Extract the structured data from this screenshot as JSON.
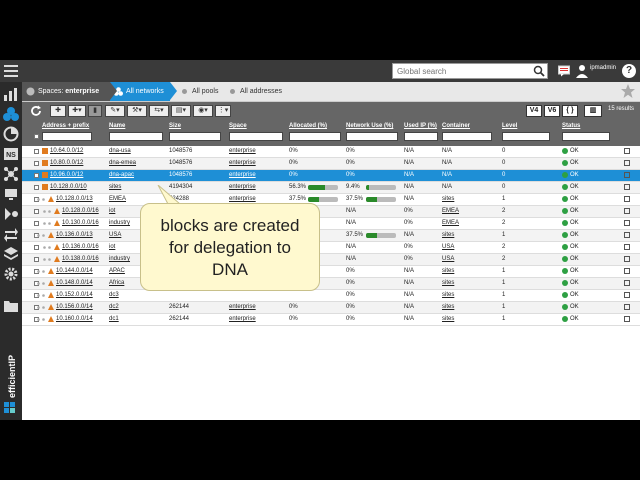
{
  "topbar": {
    "search_placeholder": "Global search",
    "user_name": "ipmadmin",
    "user_sub": "",
    "help_label": "?"
  },
  "breadcrumb": {
    "spaces_prefix": "Spaces: ",
    "spaces_value": "enterprise",
    "networks": "All networks",
    "pools": "All pools",
    "addresses": "All addresses"
  },
  "toolbar": {
    "v4": "V4",
    "v6": "V6",
    "braces": "{ }",
    "results": "15 results"
  },
  "columns": {
    "address": "Address + prefix",
    "name": "Name",
    "size": "Size",
    "space": "Space",
    "allocated": "Allocated (%)",
    "network_use": "Network Use (%)",
    "used_ip": "Used IP (%)",
    "container": "Container",
    "level": "Level",
    "status": "Status"
  },
  "rows": [
    {
      "address": "10.64.0.0/12",
      "name": "dna-usa",
      "size": "1048576",
      "space": "enterprise",
      "allocated": "0%",
      "alloc_pct": 0,
      "netuse": "0%",
      "netuse_pct": 0,
      "usedip": "N/A",
      "container": "N/A",
      "container_link": false,
      "level": "0",
      "status": "OK",
      "kind": "block",
      "depth": 0
    },
    {
      "address": "10.80.0.0/12",
      "name": "dna-emea",
      "size": "1048576",
      "space": "enterprise",
      "allocated": "0%",
      "alloc_pct": 0,
      "netuse": "0%",
      "netuse_pct": 0,
      "usedip": "N/A",
      "container": "N/A",
      "container_link": false,
      "level": "0",
      "status": "OK",
      "kind": "block",
      "depth": 0
    },
    {
      "address": "10.96.0.0/12",
      "name": "dna-apac",
      "size": "1048576",
      "space": "enterprise",
      "allocated": "0%",
      "alloc_pct": 0,
      "netuse": "0%",
      "netuse_pct": 0,
      "usedip": "N/A",
      "container": "N/A",
      "container_link": false,
      "level": "0",
      "status": "OK",
      "kind": "block",
      "depth": 0,
      "selected": true
    },
    {
      "address": "10.128.0.0/10",
      "name": "sites",
      "size": "4194304",
      "space": "enterprise",
      "allocated": "56.3%",
      "alloc_pct": 56.3,
      "netuse": "9.4%",
      "netuse_pct": 9.4,
      "usedip": "N/A",
      "container": "N/A",
      "container_link": false,
      "level": "0",
      "status": "OK",
      "kind": "block",
      "depth": 0
    },
    {
      "address": "10.128.0.0/13",
      "name": "EMEA",
      "size": "524288",
      "space": "enterprise",
      "allocated": "37.5%",
      "alloc_pct": 37.5,
      "netuse": "37.5%",
      "netuse_pct": 37.5,
      "usedip": "N/A",
      "container": "sites",
      "container_link": true,
      "level": "1",
      "status": "OK",
      "kind": "subnet",
      "depth": 1
    },
    {
      "address": "10.128.0.0/16",
      "name": "iot",
      "size": "",
      "space": "",
      "allocated": "",
      "alloc_pct": null,
      "netuse": "N/A",
      "netuse_pct": null,
      "usedip": "0%",
      "container": "EMEA",
      "container_link": true,
      "level": "2",
      "status": "OK",
      "kind": "subnet",
      "depth": 2
    },
    {
      "address": "10.130.0.0/16",
      "name": "industry",
      "size": "",
      "space": "",
      "allocated": "",
      "alloc_pct": null,
      "netuse": "N/A",
      "netuse_pct": null,
      "usedip": "0%",
      "container": "EMEA",
      "container_link": true,
      "level": "2",
      "status": "OK",
      "kind": "subnet",
      "depth": 2
    },
    {
      "address": "10.136.0.0/13",
      "name": "USA",
      "size": "",
      "space": "",
      "allocated": "",
      "alloc_pct": null,
      "netuse": "37.5%",
      "netuse_pct": 37.5,
      "usedip": "N/A",
      "container": "sites",
      "container_link": true,
      "level": "1",
      "status": "OK",
      "kind": "subnet",
      "depth": 1
    },
    {
      "address": "10.136.0.0/16",
      "name": "iot",
      "size": "",
      "space": "",
      "allocated": "",
      "alloc_pct": null,
      "netuse": "N/A",
      "netuse_pct": null,
      "usedip": "0%",
      "container": "USA",
      "container_link": true,
      "level": "2",
      "status": "OK",
      "kind": "subnet",
      "depth": 2
    },
    {
      "address": "10.138.0.0/16",
      "name": "industry",
      "size": "",
      "space": "",
      "allocated": "",
      "alloc_pct": null,
      "netuse": "N/A",
      "netuse_pct": null,
      "usedip": "0%",
      "container": "USA",
      "container_link": true,
      "level": "2",
      "status": "OK",
      "kind": "subnet",
      "depth": 2
    },
    {
      "address": "10.144.0.0/14",
      "name": "APAC",
      "size": "",
      "space": "",
      "allocated": "",
      "alloc_pct": null,
      "netuse": "0%",
      "netuse_pct": null,
      "usedip": "N/A",
      "container": "sites",
      "container_link": true,
      "level": "1",
      "status": "OK",
      "kind": "subnet",
      "depth": 1
    },
    {
      "address": "10.148.0.0/14",
      "name": "Africa",
      "size": "",
      "space": "",
      "allocated": "",
      "alloc_pct": null,
      "netuse": "0%",
      "netuse_pct": null,
      "usedip": "N/A",
      "container": "sites",
      "container_link": true,
      "level": "1",
      "status": "OK",
      "kind": "subnet",
      "depth": 1
    },
    {
      "address": "10.152.0.0/14",
      "name": "dc3",
      "size": "",
      "space": "",
      "allocated": "",
      "alloc_pct": null,
      "netuse": "0%",
      "netuse_pct": null,
      "usedip": "N/A",
      "container": "sites",
      "container_link": true,
      "level": "1",
      "status": "OK",
      "kind": "subnet",
      "depth": 1
    },
    {
      "address": "10.156.0.0/14",
      "name": "dc2",
      "size": "262144",
      "space": "enterprise",
      "allocated": "0%",
      "alloc_pct": 0,
      "netuse": "0%",
      "netuse_pct": null,
      "usedip": "N/A",
      "container": "sites",
      "container_link": true,
      "level": "1",
      "status": "OK",
      "kind": "subnet",
      "depth": 1
    },
    {
      "address": "10.160.0.0/14",
      "name": "dc1",
      "size": "262144",
      "space": "enterprise",
      "allocated": "0%",
      "alloc_pct": 0,
      "netuse": "0%",
      "netuse_pct": null,
      "usedip": "N/A",
      "container": "sites",
      "container_link": true,
      "level": "1",
      "status": "OK",
      "kind": "subnet",
      "depth": 1
    }
  ],
  "tooltip": {
    "line1": "blocks are created",
    "line2": "for delegation to",
    "line3": "DNA"
  },
  "logo": {
    "text": "efficientIP"
  },
  "colors": {
    "accent": "#1e8fd6",
    "ok": "#2ea043",
    "block": "#e07b1f",
    "bar": "#2a8a2a"
  }
}
